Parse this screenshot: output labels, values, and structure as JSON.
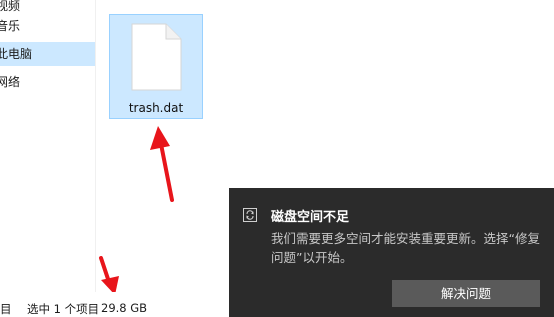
{
  "nav": {
    "items": [
      {
        "label": "视频"
      },
      {
        "label": "音乐"
      },
      {
        "label": "此电脑",
        "selected": true
      },
      {
        "label": "网络"
      }
    ]
  },
  "file": {
    "name": "trash.dat",
    "icon": "blank-file-icon"
  },
  "status": {
    "items_label": "目",
    "selection": "选中 1 个项目",
    "size": "29.8 GB"
  },
  "toast": {
    "icon": "refresh-icon",
    "title": "磁盘空间不足",
    "body": "我们需要更多空间才能安装重要更新。选择“修复问题”以开始。",
    "button_label": "解决问题"
  },
  "colors": {
    "selection": "#cce8ff",
    "toast_bg": "#2b2b2b",
    "arrow": "#e8151b"
  }
}
